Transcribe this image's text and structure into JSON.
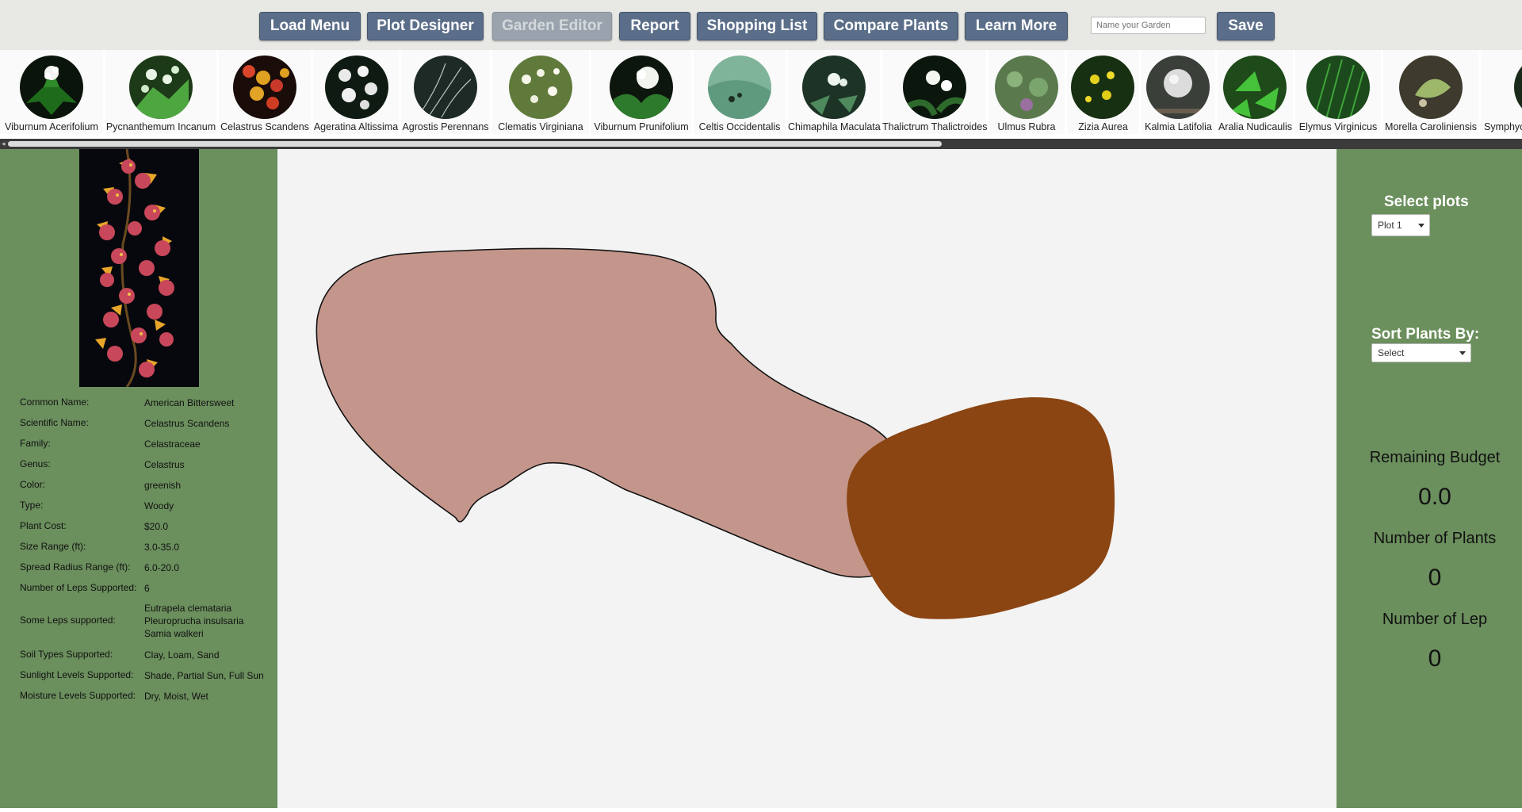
{
  "toolbar": {
    "load_menu": "Load Menu",
    "plot_designer": "Plot Designer",
    "garden_editor": "Garden Editor",
    "report": "Report",
    "shopping_list": "Shopping List",
    "compare_plants": "Compare Plants",
    "learn_more": "Learn More",
    "garden_name_placeholder": "Name your Garden",
    "save": "Save"
  },
  "plants": [
    {
      "name": "Viburnum Acerifolium",
      "icon": "plant-photo"
    },
    {
      "name": "Pycnanthemum Incanum",
      "icon": "plant-photo"
    },
    {
      "name": "Celastrus Scandens",
      "icon": "plant-photo"
    },
    {
      "name": "Ageratina Altissima",
      "icon": "plant-photo"
    },
    {
      "name": "Agrostis Perennans",
      "icon": "plant-photo"
    },
    {
      "name": "Clematis Virginiana",
      "icon": "plant-photo"
    },
    {
      "name": "Viburnum Prunifolium",
      "icon": "plant-photo"
    },
    {
      "name": "Celtis Occidentalis",
      "icon": "plant-photo"
    },
    {
      "name": "Chimaphila Maculata",
      "icon": "plant-photo"
    },
    {
      "name": "Thalictrum Thalictroides",
      "icon": "plant-photo"
    },
    {
      "name": "Ulmus Rubra",
      "icon": "plant-photo"
    },
    {
      "name": "Zizia Aurea",
      "icon": "plant-photo"
    },
    {
      "name": "Kalmia Latifolia",
      "icon": "plant-photo"
    },
    {
      "name": "Aralia Nudicaulis",
      "icon": "plant-photo"
    },
    {
      "name": "Elymus Virginicus",
      "icon": "plant-photo"
    },
    {
      "name": "Morella Caroliniensis",
      "icon": "plant-photo"
    },
    {
      "name": "Symphyo",
      "icon": "plant-photo"
    }
  ],
  "selected_plant": {
    "rows": [
      {
        "label": "Common Name:",
        "value": "American Bittersweet"
      },
      {
        "label": "Scientific Name:",
        "value": "Celastrus Scandens"
      },
      {
        "label": "Family:",
        "value": "Celastraceae"
      },
      {
        "label": "Genus:",
        "value": "Celastrus"
      },
      {
        "label": "Color:",
        "value": "greenish"
      },
      {
        "label": "Type:",
        "value": "Woody"
      },
      {
        "label": "Plant Cost:",
        "value": "$20.0"
      },
      {
        "label": "Size Range (ft):",
        "value": "3.0-35.0"
      },
      {
        "label": "Spread Radius Range (ft):",
        "value": "6.0-20.0"
      },
      {
        "label": "Number of Leps Supported:",
        "value": "6"
      },
      {
        "label": "Some Leps supported:",
        "value": "Eutrapela clemataria\nPleuroprucha insulsaria\nSamia walkeri"
      },
      {
        "label": "Soil Types Supported:",
        "value": "Clay, Loam, Sand"
      },
      {
        "label": "Sunlight Levels Supported:",
        "value": "Shade, Partial Sun, Full Sun"
      },
      {
        "label": "Moisture Levels Supported:",
        "value": "Dry, Moist, Wet"
      }
    ]
  },
  "canvas": {
    "plot_colors": [
      "#c4968b",
      "#8b4513"
    ]
  },
  "sidebar": {
    "select_plots_label": "Select plots",
    "plot_selected": "Plot 1",
    "sort_label": "Sort Plants By:",
    "sort_selected": "Select",
    "remaining_budget_label": "Remaining Budget",
    "remaining_budget": "0.0",
    "num_plants_label": "Number of Plants",
    "num_plants": "0",
    "num_lep_label": "Number of Lep",
    "num_lep": "0"
  },
  "colors": {
    "panel_green": "#6b8f5d",
    "button_blue": "#5b6e89",
    "canvas_bg": "#f3f3f3"
  }
}
